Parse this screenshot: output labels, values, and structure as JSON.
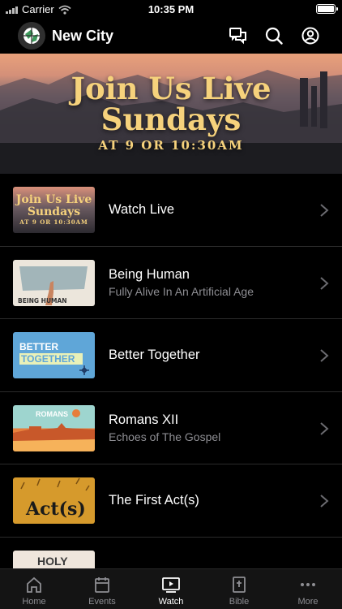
{
  "status_bar": {
    "carrier": "Carrier",
    "time": "10:35 PM"
  },
  "header": {
    "title": "New City",
    "icons": [
      "chat-icon",
      "search-icon",
      "profile-icon"
    ]
  },
  "hero": {
    "line1": "Join Us Live",
    "line2": "Sundays",
    "line3": "AT 9 OR 10:30AM"
  },
  "thumbs": {
    "live_line1": "Join Us Live",
    "live_line2": "Sundays",
    "live_line3": "AT 9 OR 10:30AM",
    "human_text": "BEING HUMAN",
    "better_line1": "BETTER",
    "better_line2": "TOGETHER",
    "romans_text": "ROMANS",
    "act_text": "Act(s)",
    "holy_text": "HOLY"
  },
  "list": [
    {
      "title": "Watch Live",
      "subtitle": ""
    },
    {
      "title": "Being Human",
      "subtitle": "Fully Alive In An Artificial Age"
    },
    {
      "title": "Better Together",
      "subtitle": ""
    },
    {
      "title": "Romans XII",
      "subtitle": "Echoes of The Gospel"
    },
    {
      "title": "The First Act(s)",
      "subtitle": ""
    },
    {
      "title": "",
      "subtitle": ""
    }
  ],
  "tabs": [
    {
      "label": "Home",
      "icon": "home-icon",
      "active": false
    },
    {
      "label": "Events",
      "icon": "calendar-icon",
      "active": false
    },
    {
      "label": "Watch",
      "icon": "play-icon",
      "active": true
    },
    {
      "label": "Bible",
      "icon": "bible-icon",
      "active": false
    },
    {
      "label": "More",
      "icon": "more-icon",
      "active": false
    }
  ],
  "colors": {
    "background": "#000000",
    "accent_gold": "#f6d27c",
    "subtitle_gray": "#8e8e93"
  }
}
